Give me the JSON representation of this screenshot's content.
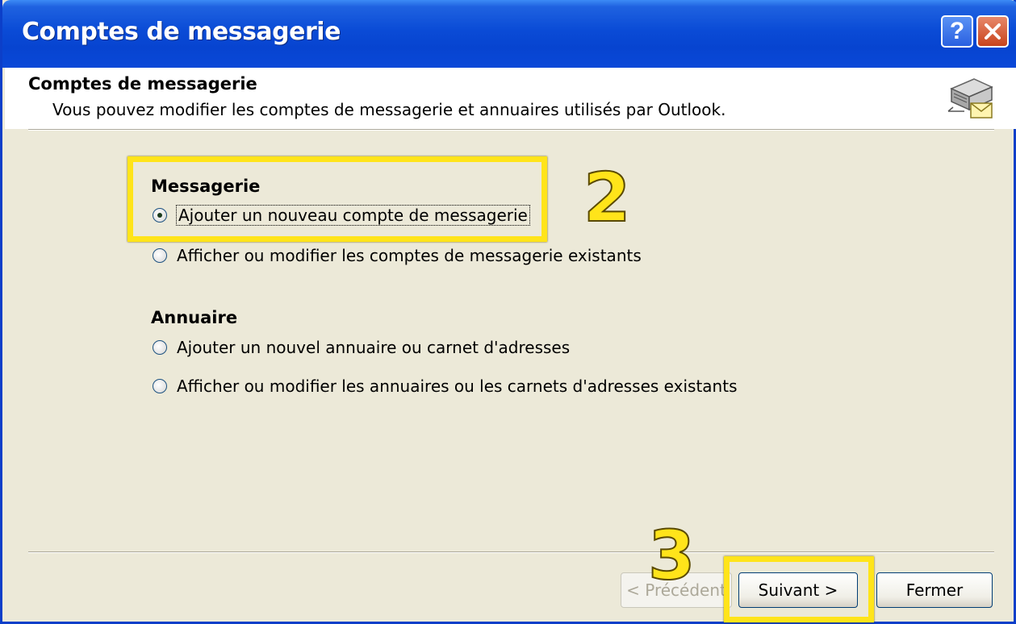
{
  "window": {
    "title": "Comptes de messagerie",
    "help_button": "?",
    "close_button": "✕"
  },
  "header": {
    "title": "Comptes de messagerie",
    "subtitle": "Vous pouvez modifier les comptes de messagerie et annuaires utilisés par Outlook.",
    "icon": "mail-server-icon"
  },
  "groups": {
    "messagerie": {
      "title": "Messagerie",
      "options": [
        {
          "label": "Ajouter un nouveau compte de messagerie",
          "checked": true
        },
        {
          "label": "Afficher ou modifier les comptes de messagerie existants",
          "checked": false
        }
      ]
    },
    "annuaire": {
      "title": "Annuaire",
      "options": [
        {
          "label": "Ajouter un nouvel annuaire ou carnet d'adresses",
          "checked": false
        },
        {
          "label": "Afficher ou modifier les annuaires ou les carnets d'adresses existants",
          "checked": false
        }
      ]
    }
  },
  "buttons": {
    "previous": "< Précédent",
    "next": "Suivant >",
    "close": "Fermer"
  },
  "annotations": {
    "step2": "2",
    "step3": "3",
    "highlight_color": "#ffe41a"
  }
}
